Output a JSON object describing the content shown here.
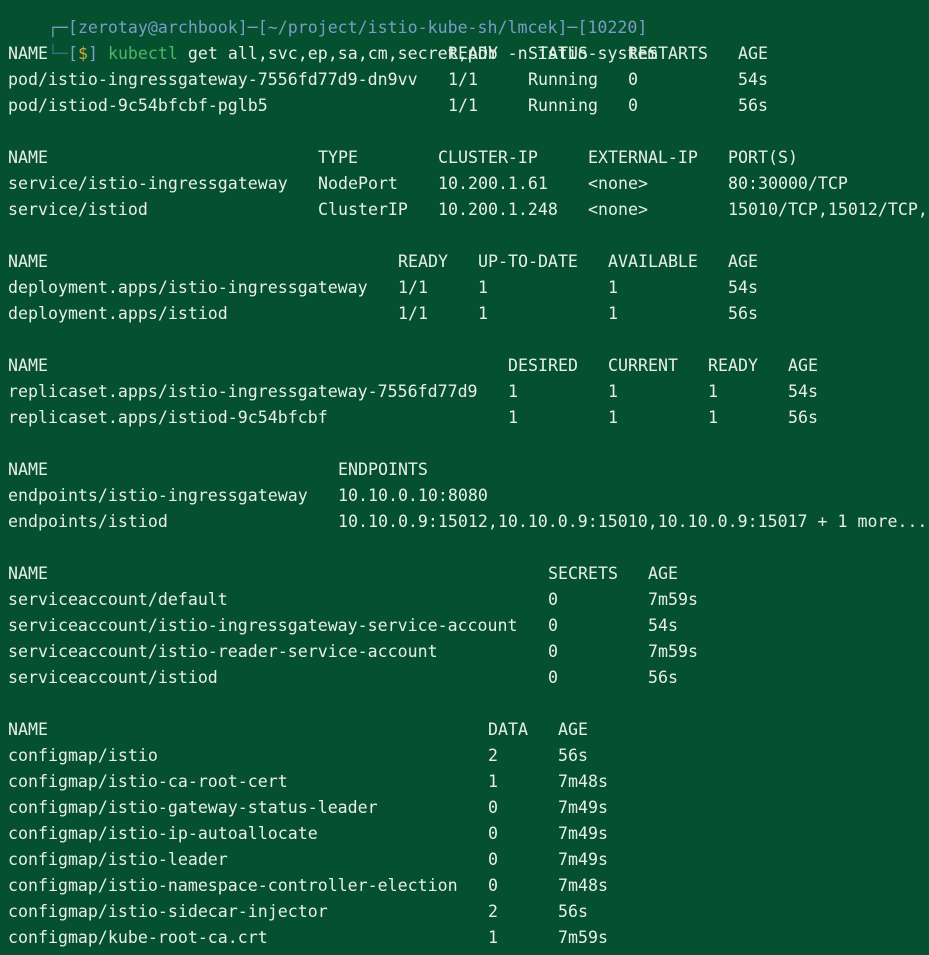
{
  "prompt": {
    "top_line": "┌─[zerotay@archbook]─[~/project/istio-kube-sh/lmcek]─[10220]",
    "corner": "└─",
    "open_bracket": "[",
    "dollar": "$",
    "close_bracket": "]",
    "command_keyword": "kubectl",
    "command_args": "get all,svc,ep,sa,cm,secret,pdb -n istio-system"
  },
  "pods": {
    "headers": [
      "NAME",
      "READY",
      "STATUS",
      "RESTARTS",
      "AGE"
    ],
    "rows": [
      [
        "pod/istio-ingressgateway-7556fd77d9-dn9vv",
        "1/1",
        "Running",
        "0",
        "54s"
      ],
      [
        "pod/istiod-9c54bfcbf-pglb5",
        "1/1",
        "Running",
        "0",
        "56s"
      ]
    ]
  },
  "services": {
    "headers": [
      "NAME",
      "TYPE",
      "CLUSTER-IP",
      "EXTERNAL-IP",
      "PORT(S)"
    ],
    "rows": [
      [
        "service/istio-ingressgateway",
        "NodePort",
        "10.200.1.61",
        "<none>",
        "80:30000/TCP"
      ],
      [
        "service/istiod",
        "ClusterIP",
        "10.200.1.248",
        "<none>",
        "15010/TCP,15012/TCP,"
      ]
    ]
  },
  "deployments": {
    "headers": [
      "NAME",
      "READY",
      "UP-TO-DATE",
      "AVAILABLE",
      "AGE"
    ],
    "rows": [
      [
        "deployment.apps/istio-ingressgateway",
        "1/1",
        "1",
        "1",
        "54s"
      ],
      [
        "deployment.apps/istiod",
        "1/1",
        "1",
        "1",
        "56s"
      ]
    ]
  },
  "replicasets": {
    "headers": [
      "NAME",
      "DESIRED",
      "CURRENT",
      "READY",
      "AGE"
    ],
    "rows": [
      [
        "replicaset.apps/istio-ingressgateway-7556fd77d9",
        "1",
        "1",
        "1",
        "54s"
      ],
      [
        "replicaset.apps/istiod-9c54bfcbf",
        "1",
        "1",
        "1",
        "56s"
      ]
    ]
  },
  "endpoints": {
    "headers": [
      "NAME",
      "ENDPOINTS"
    ],
    "rows": [
      [
        "endpoints/istio-ingressgateway",
        "10.10.0.10:8080"
      ],
      [
        "endpoints/istiod",
        "10.10.0.9:15012,10.10.0.9:15010,10.10.0.9:15017 + 1 more..."
      ]
    ]
  },
  "serviceaccounts": {
    "headers": [
      "NAME",
      "SECRETS",
      "AGE"
    ],
    "rows": [
      [
        "serviceaccount/default",
        "0",
        "7m59s"
      ],
      [
        "serviceaccount/istio-ingressgateway-service-account",
        "0",
        "54s"
      ],
      [
        "serviceaccount/istio-reader-service-account",
        "0",
        "7m59s"
      ],
      [
        "serviceaccount/istiod",
        "0",
        "56s"
      ]
    ]
  },
  "configmaps": {
    "headers": [
      "NAME",
      "DATA",
      "AGE"
    ],
    "rows": [
      [
        "configmap/istio",
        "2",
        "56s"
      ],
      [
        "configmap/istio-ca-root-cert",
        "1",
        "7m48s"
      ],
      [
        "configmap/istio-gateway-status-leader",
        "0",
        "7m49s"
      ],
      [
        "configmap/istio-ip-autoallocate",
        "0",
        "7m49s"
      ],
      [
        "configmap/istio-leader",
        "0",
        "7m49s"
      ],
      [
        "configmap/istio-namespace-controller-election",
        "0",
        "7m48s"
      ],
      [
        "configmap/istio-sidecar-injector",
        "2",
        "56s"
      ],
      [
        "configmap/kube-root-ca.crt",
        "1",
        "7m59s"
      ]
    ]
  },
  "colors": {
    "background": "#04502f",
    "text": "#e8efe9",
    "prompt_path": "#7a9cc6",
    "prompt_dollar": "#d0a640",
    "kubectl": "#4fb56a"
  }
}
